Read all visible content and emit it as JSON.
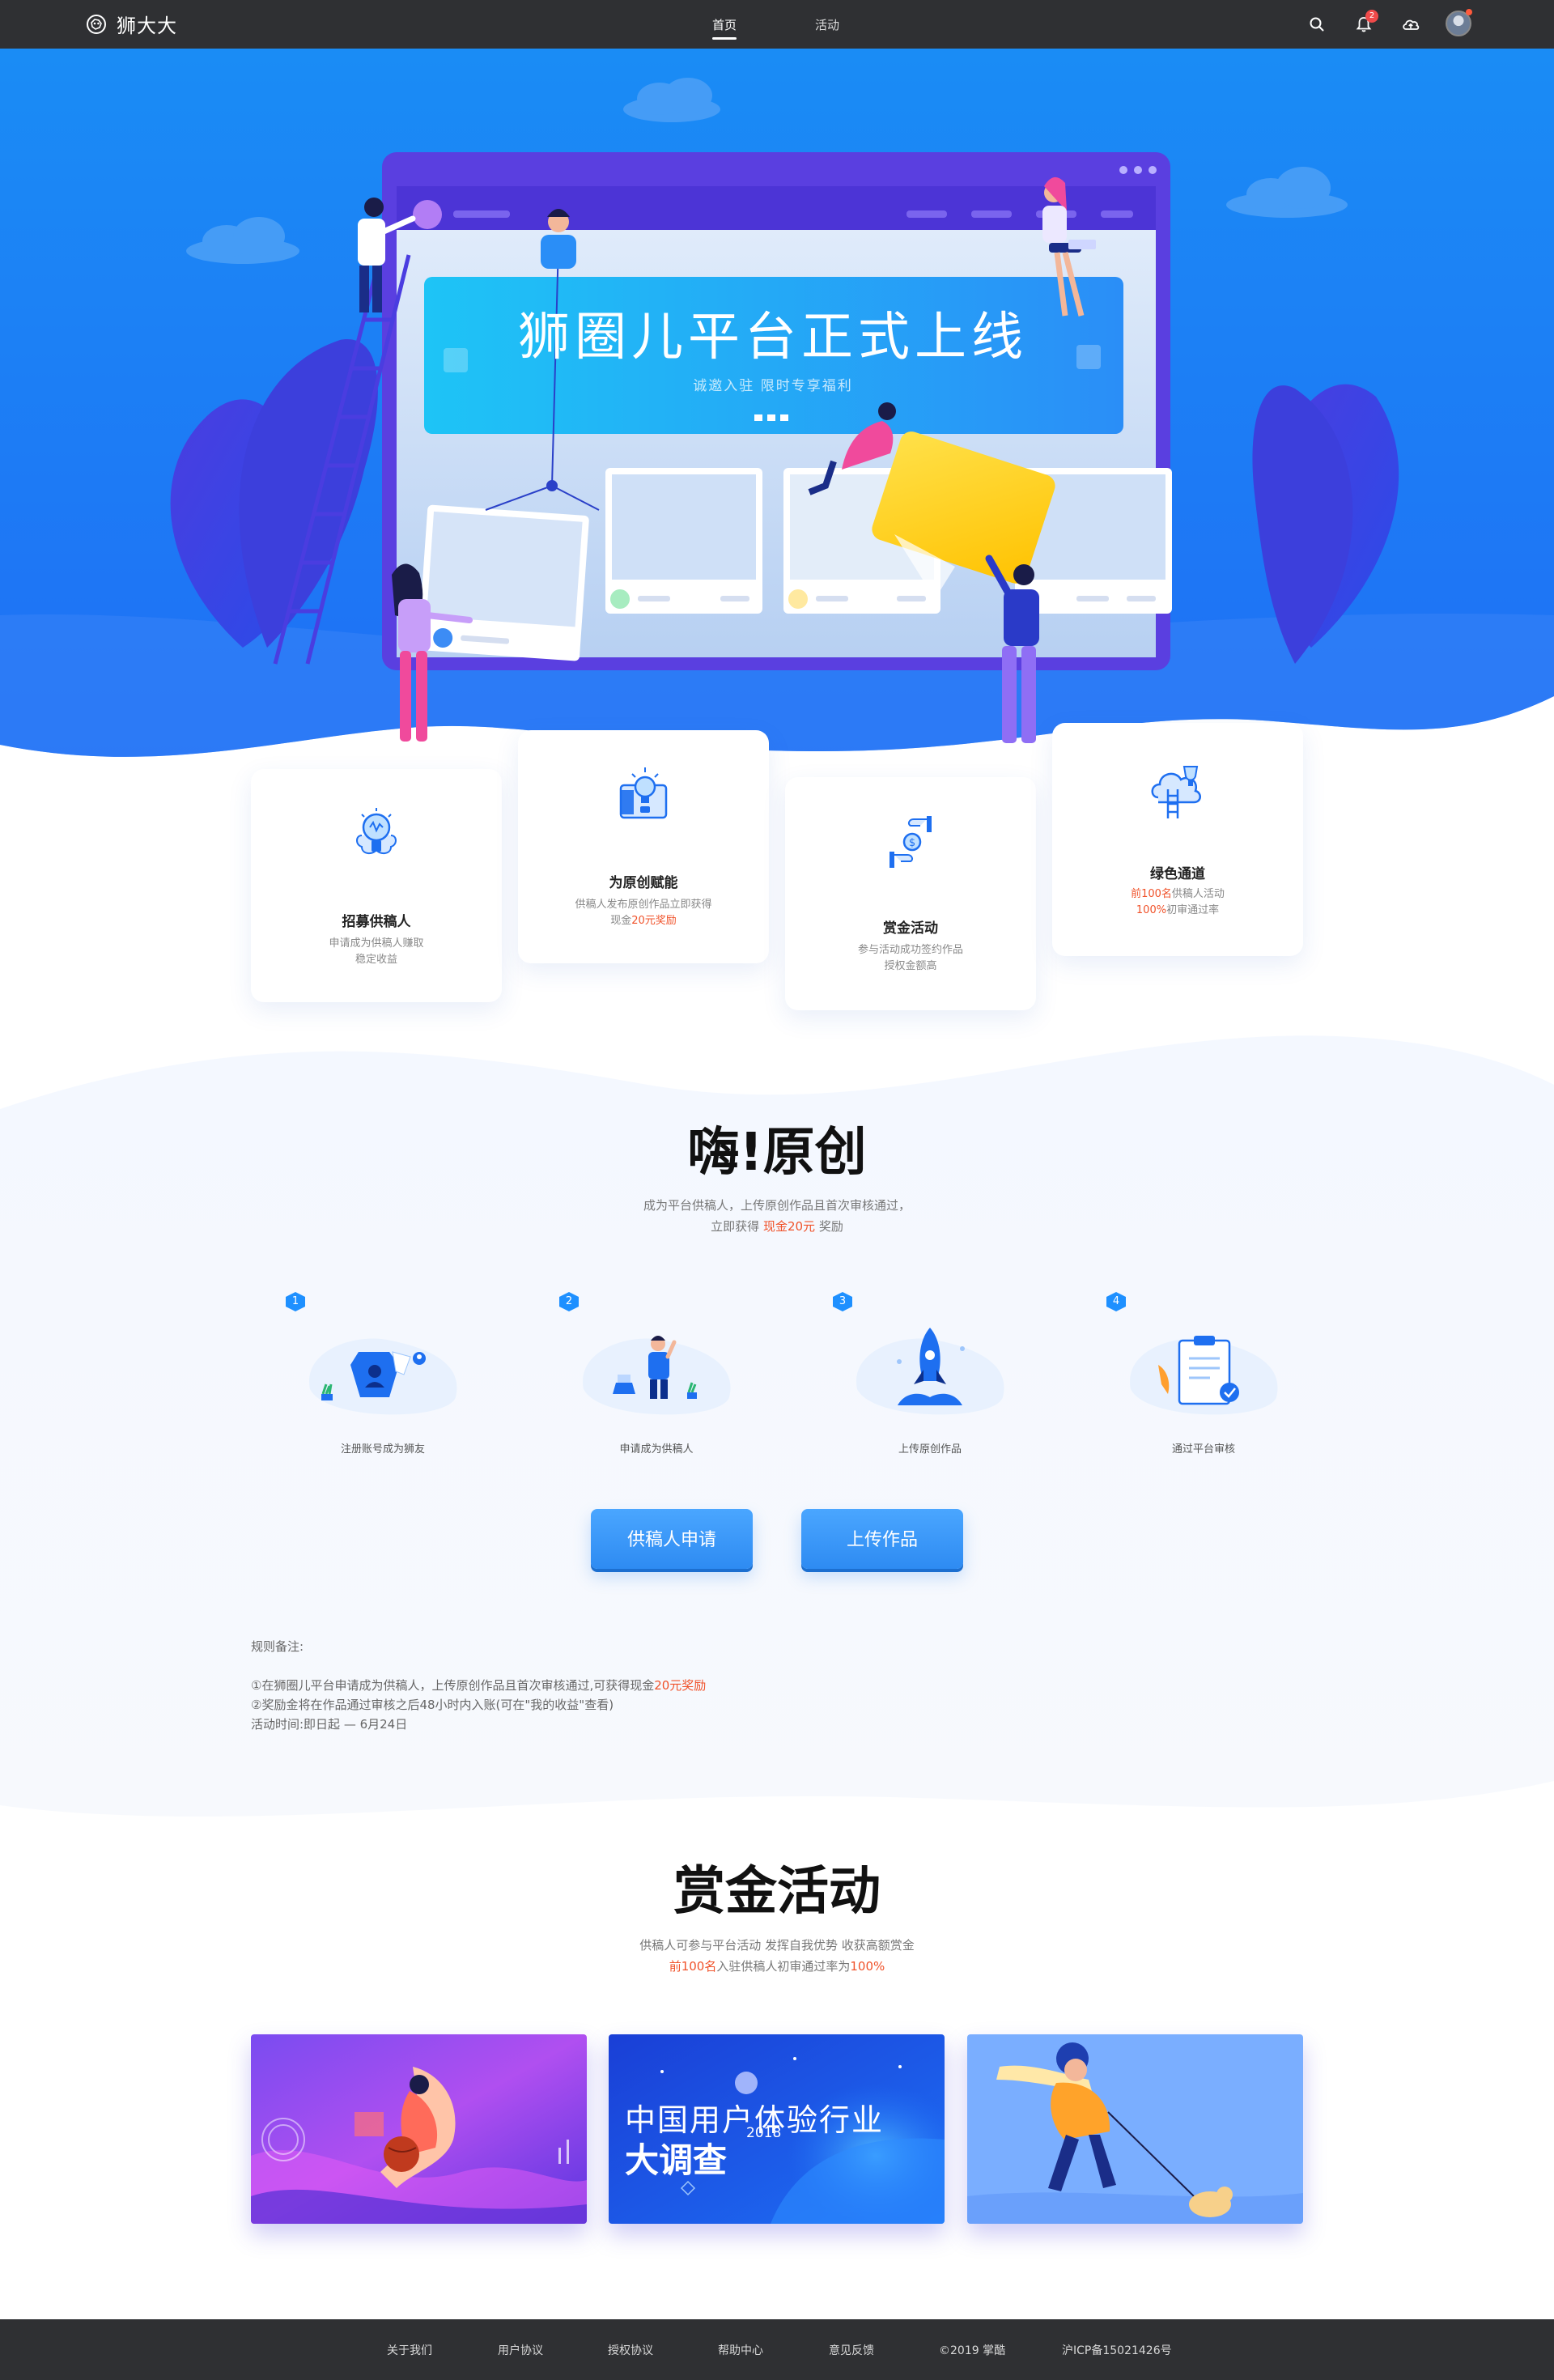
{
  "nav": {
    "brand": "狮大大",
    "links": [
      {
        "label": "首页",
        "active": true
      },
      {
        "label": "活动",
        "active": false
      }
    ],
    "notification_count": "2",
    "icons": [
      "search-icon",
      "bell-icon",
      "cloud-upload-icon",
      "avatar"
    ]
  },
  "hero": {
    "title": "狮圈儿平台正式上线",
    "subtitle": "诚邀入驻 限时专享福利"
  },
  "features": [
    {
      "title": "招募供稿人",
      "desc_1": "申请成为供稿人赚取",
      "desc_2": "稳定收益",
      "icon": "lightbulb-brain-icon"
    },
    {
      "title": "为原创赋能",
      "desc_1": "供稿人发布原创作品立即获得",
      "desc_2_pre": "现金",
      "desc_2_hl": "20元奖励",
      "icon": "lightbulb-wallet-icon"
    },
    {
      "title": "赏金活动",
      "desc_1": "参与活动成功签约作品",
      "desc_2": "授权金额高",
      "icon": "money-exchange-icon"
    },
    {
      "title": "绿色通道",
      "desc_1_hl": "前100名",
      "desc_1": "供稿人活动",
      "desc_2_hl": "100%",
      "desc_2": "初审通过率",
      "icon": "cloud-trophy-icon"
    }
  ],
  "original": {
    "title": "嗨!原创",
    "sub_1": "成为平台供稿人，上传原创作品且首次审核通过，",
    "sub_2_pre": "立即获得 ",
    "sub_2_hl": "现金20元",
    "sub_2_post": " 奖励",
    "steps": [
      {
        "num": "1",
        "label": "注册账号成为狮友"
      },
      {
        "num": "2",
        "label": "申请成为供稿人"
      },
      {
        "num": "3",
        "label": "上传原创作品"
      },
      {
        "num": "4",
        "label": "通过平台审核"
      }
    ],
    "buttons": {
      "apply": "供稿人申请",
      "upload": "上传作品"
    },
    "rules": {
      "heading": "规则备注:",
      "line_1_pre": "①在狮圈儿平台申请成为供稿人，上传原创作品且首次审核通过,可获得现金",
      "line_1_hl": "20元奖励",
      "line_2": "②奖励金将在作品通过审核之后48小时内入账(可在\"我的收益\"查看)",
      "line_3": "活动时间:即日起 — 6月24日"
    }
  },
  "bounty": {
    "title": "赏金活动",
    "sub_1": "供稿人可参与平台活动 发挥自我优势 收获高额赏金",
    "sub_2_hl1": "前100名",
    "sub_2_mid": "入驻供稿人初审通过率为",
    "sub_2_hl2": "100%",
    "banners": [
      {
        "name": "basketball-banner"
      },
      {
        "name": "survey-banner",
        "line_1": "中国用户体验行业",
        "line_2": "大调查",
        "year": "2018"
      },
      {
        "name": "dog-walk-banner"
      }
    ]
  },
  "footer": {
    "links": [
      "关于我们",
      "用户协议",
      "授权协议",
      "帮助中心",
      "意见反馈",
      "©2019 掌酷",
      "沪ICP备15021426号"
    ]
  },
  "colors": {
    "nav_bg": "#2f3033",
    "primary_blue": "#1e90ff",
    "highlight_red": "#f0522a",
    "hero_blue": "#1f6ff5"
  }
}
